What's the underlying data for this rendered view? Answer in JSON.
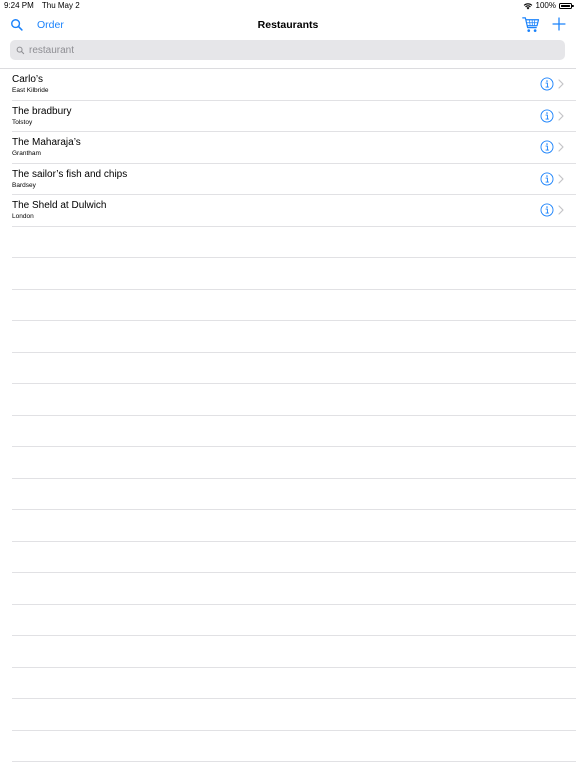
{
  "status_bar": {
    "time": "9:24 PM",
    "date": "Thu May 2",
    "battery": "100%"
  },
  "nav": {
    "order_label": "Order",
    "title": "Restaurants"
  },
  "search": {
    "placeholder": "restaurant"
  },
  "restaurants": [
    {
      "name": "Carlo’s",
      "location": "East Kilbride"
    },
    {
      "name": "The bradbury",
      "location": "Tolstoy"
    },
    {
      "name": "The Maharaja’s",
      "location": "Grantham"
    },
    {
      "name": "The sailor’s fish and chips",
      "location": "Bardsey"
    },
    {
      "name": "The Sheld at Dulwich",
      "location": "London"
    }
  ],
  "colors": {
    "accent": "#1a82fb",
    "separator": "#e1e1e4",
    "search_bg": "#e6e6e9"
  },
  "icons": [
    "search-icon",
    "cart-icon",
    "plus-icon",
    "info-icon",
    "chevron-right-icon",
    "wifi-icon",
    "battery-icon"
  ]
}
